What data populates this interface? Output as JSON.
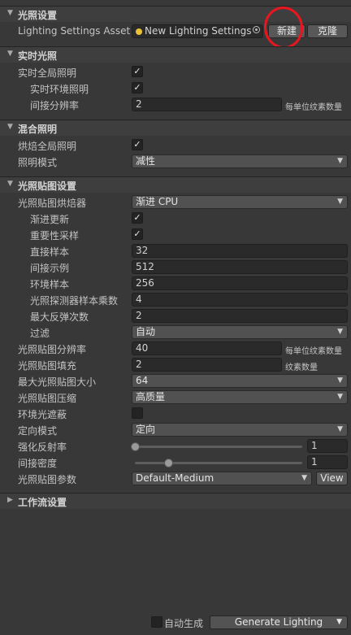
{
  "colors": {
    "panel": "#383838",
    "section": "#3e3e3e",
    "field": "#2a2a2a",
    "dropdown": "#515151",
    "button": "#585858",
    "annotation": "#e8161e"
  },
  "icons": {
    "collapse": "triangle-down-icon",
    "expand": "triangle-right-icon",
    "dropdown": "chevron-down-icon",
    "check": "checkmark-icon",
    "asset": "lighting-settings-asset-icon",
    "picker": "object-picker-icon"
  },
  "lighting": {
    "title": "光照设置",
    "asset_label": "Lighting Settings Asset",
    "asset_value": "New Lighting Settings",
    "new_button": "新建",
    "clone_button": "克隆"
  },
  "realtime": {
    "title": "实时光照",
    "global_gi": "实时全局照明",
    "global_gi_checked": true,
    "env_lighting": "实时环境照明",
    "env_lighting_checked": true,
    "indirect_res": "间接分辨率",
    "indirect_res_value": "2",
    "indirect_res_unit": "每单位纹素数量"
  },
  "mixed": {
    "title": "混合照明",
    "baked_gi": "烘焙全局照明",
    "baked_gi_checked": true,
    "lighting_mode": "照明模式",
    "lighting_mode_value": "减性"
  },
  "lightmap": {
    "title": "光照贴图设置",
    "baker": "光照贴图烘焙器",
    "baker_value": "渐进 CPU",
    "progressive_update": "渐进更新",
    "progressive_update_checked": true,
    "importance_sampling": "重要性采样",
    "importance_sampling_checked": true,
    "direct_samples": "直接样本",
    "direct_samples_value": "32",
    "indirect_samples": "间接示例",
    "indirect_samples_value": "512",
    "env_samples": "环境样本",
    "env_samples_value": "256",
    "probe_multiplier": "光照探测器样本乘数",
    "probe_multiplier_value": "4",
    "max_bounces": "最大反弹次数",
    "max_bounces_value": "2",
    "filtering": "过滤",
    "filtering_value": "自动",
    "resolution": "光照贴图分辨率",
    "resolution_value": "40",
    "resolution_unit": "每单位纹素数量",
    "padding": "光照贴图填充",
    "padding_value": "2",
    "padding_unit": "纹素数量",
    "max_size": "最大光照贴图大小",
    "max_size_value": "64",
    "compression": "光照贴图压缩",
    "compression_value": "高质量",
    "ao": "环境光遮蔽",
    "ao_checked": false,
    "directional": "定向模式",
    "directional_value": "定向",
    "albedo_boost": "强化反射率",
    "albedo_boost_value": "1",
    "albedo_boost_level": 0.0,
    "indirect_intensity": "间接密度",
    "indirect_intensity_value": "1",
    "indirect_intensity_level": 0.2,
    "params": "光照贴图参数",
    "params_value": "Default-Medium",
    "view_button": "View"
  },
  "workflow": {
    "title": "工作流设置"
  },
  "footer": {
    "auto_generate": "自动生成",
    "auto_generate_checked": false,
    "generate_button": "Generate Lighting"
  }
}
